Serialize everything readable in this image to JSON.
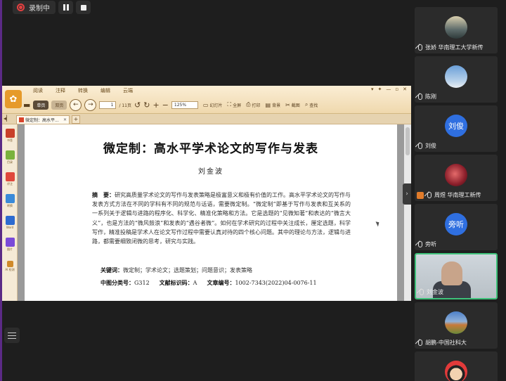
{
  "recording": {
    "label": "录制中"
  },
  "reader": {
    "menu_tabs": [
      "阅读",
      "注释",
      "转换",
      "编辑",
      "云端"
    ],
    "tools": {
      "single_page": "单页",
      "double_page": "双页",
      "page_current": "1",
      "page_total": "/ 11页",
      "zoom": "125%",
      "slideshow": "幻灯片",
      "fullscreen": "全屏",
      "print": "打印",
      "background": "背景",
      "screenshot": "截图",
      "search": "查找"
    },
    "doc_tab": "微定制：高水平...",
    "side_items": [
      "书签",
      "目录",
      "评注",
      "转换",
      "Word",
      "图片",
      "AI 检测"
    ]
  },
  "paper": {
    "title": "微定制：高水平学术论文的写作与发表",
    "author": "刘金波",
    "abstract_label": "摘　要：",
    "abstract_text": "研究高质量学术论文的写作与发表策略是极富意义和极有价值的工作。高水平学术论文的写作与发表方式方法在不同的学科有不同的规范与话语，需要微定制。“微定制”即基于写作与发表和互关系的一系列关于逻辑与进路的程序化、科学化、精准化策略和方法。它是选题的“见微知著”和表达的“微言大义”，也是方法的“微风鼓浪”和发表的“遇谷者微”。如何在学术研究的过程中关注成长，厘定选题，科学写作，精准投稿是学术人在论文写作过程中需要认真对待的四个核心问题。其中的理论与方法，逻辑与进路，都需要细致闭微的思考，研究与实践。",
    "keywords_label": "关键词：",
    "keywords_text": "微定制；学术论文；选题策划；问题意识；发表策略",
    "clc_label": "中图分类号：",
    "clc_value": "G312",
    "doc_code_label": "文献标识码：",
    "doc_code_value": "A",
    "article_no_label": "文章编号：",
    "article_no_value": "1002-7343(2022)04-0076-11"
  },
  "participants": [
    {
      "name": "张娇 华南理工大学新传",
      "avatar": "photo-landscape",
      "host": false
    },
    {
      "name": "陈刚",
      "avatar": "photo-sky",
      "host": false
    },
    {
      "name": "刘俊",
      "avatar_text": "刘俊",
      "host": false
    },
    {
      "name": "周煜 华南理工新传",
      "avatar": "photo-red",
      "host": true
    },
    {
      "name": "旁听",
      "avatar_text": "旁听",
      "host": false
    },
    {
      "name": "刘金波",
      "video": true,
      "host": false,
      "active": true
    },
    {
      "name": "胡鹏-中国社科大",
      "avatar": "photo-field",
      "host": false
    },
    {
      "name": "",
      "avatar": "photo-cartoon",
      "host": false
    }
  ],
  "colors": {
    "accent_green": "#3ec27a",
    "avatar_blue": "#2f6fe0",
    "record_red": "#e34040"
  }
}
